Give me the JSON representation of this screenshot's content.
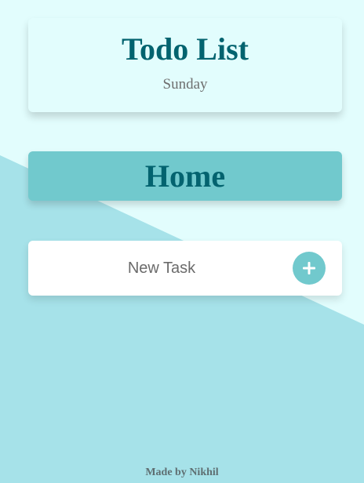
{
  "header": {
    "title": "Todo List",
    "day": "Sunday"
  },
  "list": {
    "title": "Home"
  },
  "new_task": {
    "placeholder": "New Task",
    "value": "",
    "add_icon": "plus-icon"
  },
  "footer": {
    "credit": "Made by Nikhil"
  },
  "colors": {
    "background_light": "#e2fdfd",
    "background_wedge": "#a6e2e9",
    "accent": "#71c9cd",
    "title_text": "#03636f",
    "muted_text": "#6e6e6e"
  }
}
